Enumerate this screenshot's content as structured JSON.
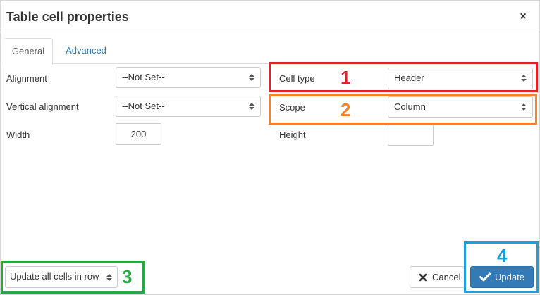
{
  "dialog": {
    "title": "Table cell properties",
    "close_symbol": "×"
  },
  "tabs": [
    {
      "label": "General",
      "active": true
    },
    {
      "label": "Advanced",
      "active": false
    }
  ],
  "general": {
    "alignment": {
      "label": "Alignment",
      "value": "--Not Set--"
    },
    "vertical_alignment": {
      "label": "Vertical alignment",
      "value": "--Not Set--"
    },
    "width": {
      "label": "Width",
      "value": "200"
    },
    "cell_type": {
      "label": "Cell type",
      "value": "Header"
    },
    "scope": {
      "label": "Scope",
      "value": "Column"
    },
    "height": {
      "label": "Height",
      "value": ""
    }
  },
  "footer": {
    "update_scope": {
      "value": "Update all cells in row"
    },
    "cancel_label": "Cancel",
    "update_label": "Update"
  },
  "annotations": [
    {
      "number": "1",
      "color": "#e0222b"
    },
    {
      "number": "2",
      "color": "#f5822a"
    },
    {
      "number": "3",
      "color": "#28a745"
    },
    {
      "number": "4",
      "color": "#1e9ee0"
    }
  ],
  "colors": {
    "primary_button": "#337ab7",
    "link": "#337ab7"
  },
  "icons": [
    "close-icon",
    "select-caret-icon",
    "x-icon",
    "checkmark-icon"
  ]
}
